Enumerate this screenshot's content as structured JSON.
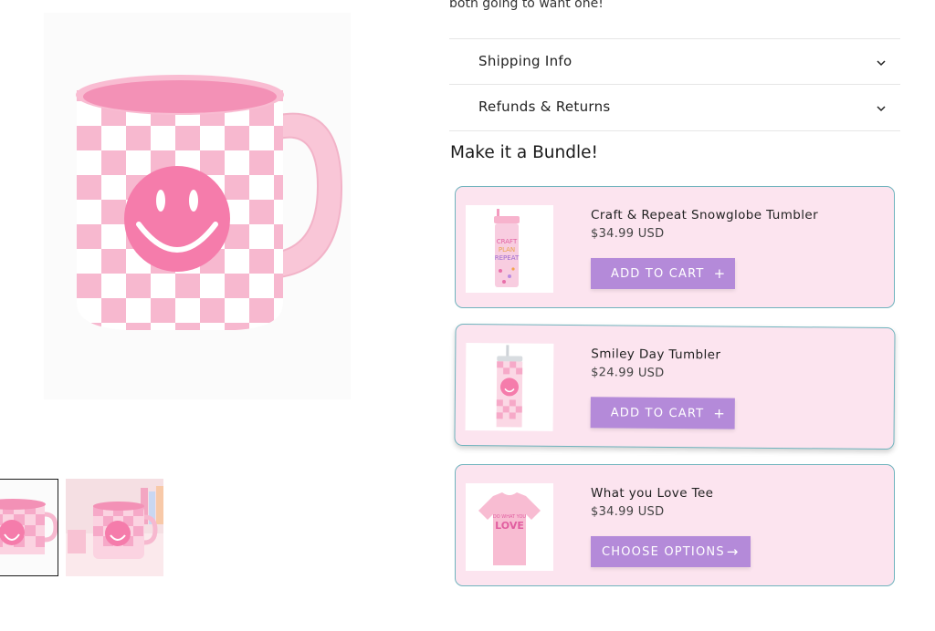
{
  "product": {
    "description_tail": "both going to want one!"
  },
  "accordions": [
    {
      "label": "Shipping Info"
    },
    {
      "label": "Refunds & Returns"
    }
  ],
  "bundle": {
    "title": "Make it a Bundle!",
    "items": [
      {
        "name": "Craft & Repeat Snowglobe Tumbler",
        "price": "$34.99 USD",
        "button": "ADD TO CART",
        "button_icon": "+",
        "image": "snowglobe-tumbler",
        "image_text": [
          "CRAFT",
          "PLAN",
          "REPEAT"
        ]
      },
      {
        "name": "Smiley Day Tumbler",
        "price": "$24.99 USD",
        "button": "ADD TO CART",
        "button_icon": "+",
        "image": "smiley-tumbler"
      },
      {
        "name": "What you Love Tee",
        "price": "$34.99 USD",
        "button": "CHOOSE OPTIONS",
        "button_icon": "→",
        "image": "love-tee",
        "image_text": [
          "DO WHAT YOU",
          "LOVE"
        ]
      }
    ]
  },
  "colors": {
    "card_bg": "#fce4ef",
    "card_border": "#6fb3bd",
    "button": "#b48ad9",
    "mug_pink": "#f6a9c8"
  }
}
